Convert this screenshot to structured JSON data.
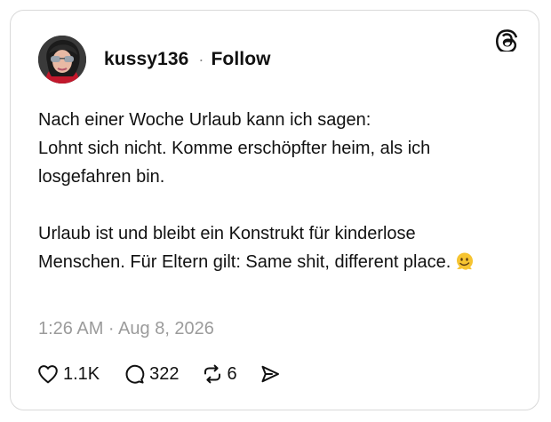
{
  "post": {
    "username": "kussy136",
    "separator": "·",
    "follow_label": "Follow",
    "paragraphs": [
      "Nach einer Woche Urlaub kann ich sagen:\nLohnt sich nicht. Komme erschöpfter heim, als ich losgefahren bin.",
      "Urlaub ist und bleibt ein Konstrukt für kinderlose Menschen. Für Eltern gilt: Same shit, different place."
    ],
    "emoji": "melting-face-emoji",
    "timestamp": "1:26 AM · Aug 8, 2026",
    "stats": {
      "likes": "1.1K",
      "replies": "322",
      "reposts": "6"
    }
  },
  "icons": {
    "brand": "threads-logo-icon",
    "like": "heart-icon",
    "reply": "speech-bubble-icon",
    "repost": "repost-arrows-icon",
    "share": "send-icon"
  },
  "colors": {
    "text": "#111111",
    "muted": "#9b9b9b",
    "border": "#d9d9d9",
    "emoji": "#f6c431"
  }
}
